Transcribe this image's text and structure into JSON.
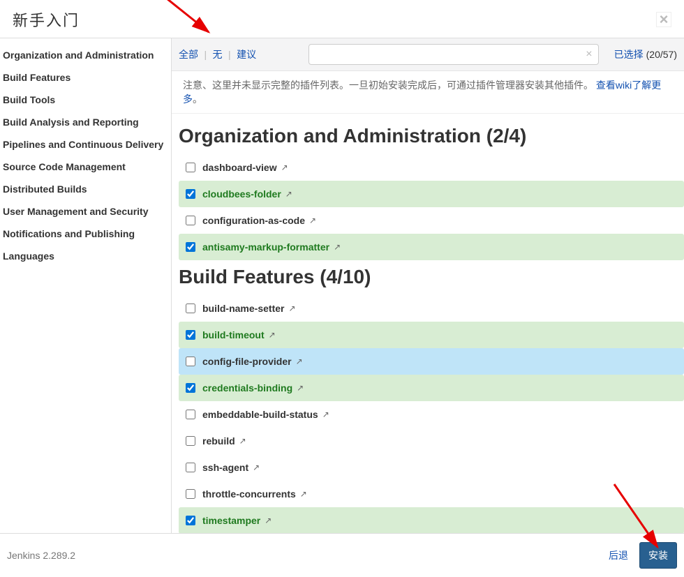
{
  "header": {
    "title": "新手入门"
  },
  "sidebar": {
    "items": [
      {
        "label": "Organization and Administration"
      },
      {
        "label": "Build Features"
      },
      {
        "label": "Build Tools"
      },
      {
        "label": "Build Analysis and Reporting"
      },
      {
        "label": "Pipelines and Continuous Delivery"
      },
      {
        "label": "Source Code Management"
      },
      {
        "label": "Distributed Builds"
      },
      {
        "label": "User Management and Security"
      },
      {
        "label": "Notifications and Publishing"
      },
      {
        "label": "Languages"
      }
    ]
  },
  "toolbar": {
    "filters": {
      "all": "全部",
      "none": "无",
      "suggested": "建议"
    },
    "search_placeholder": "",
    "selected_label": "已选择",
    "selected_count": "(20/57)"
  },
  "notice": {
    "text": "注意、这里并未显示完整的插件列表。一旦初始安装完成后，可通过插件管理器安装其他插件。",
    "link": "查看wiki了解更多",
    "after": "。"
  },
  "sections": [
    {
      "title": "Organization and Administration (2/4)",
      "plugins": [
        {
          "name": "dashboard-view",
          "checked": false,
          "highlight": false
        },
        {
          "name": "cloudbees-folder",
          "checked": true,
          "highlight": false
        },
        {
          "name": "configuration-as-code",
          "checked": false,
          "highlight": false
        },
        {
          "name": "antisamy-markup-formatter",
          "checked": true,
          "highlight": false
        }
      ]
    },
    {
      "title": "Build Features (4/10)",
      "plugins": [
        {
          "name": "build-name-setter",
          "checked": false,
          "highlight": false
        },
        {
          "name": "build-timeout",
          "checked": true,
          "highlight": false
        },
        {
          "name": "config-file-provider",
          "checked": false,
          "highlight": true
        },
        {
          "name": "credentials-binding",
          "checked": true,
          "highlight": false
        },
        {
          "name": "embeddable-build-status",
          "checked": false,
          "highlight": false
        },
        {
          "name": "rebuild",
          "checked": false,
          "highlight": false
        },
        {
          "name": "ssh-agent",
          "checked": false,
          "highlight": false
        },
        {
          "name": "throttle-concurrents",
          "checked": false,
          "highlight": false
        },
        {
          "name": "timestamper",
          "checked": true,
          "highlight": false
        }
      ]
    }
  ],
  "footer": {
    "version": "Jenkins 2.289.2",
    "back": "后退",
    "install": "安装"
  }
}
